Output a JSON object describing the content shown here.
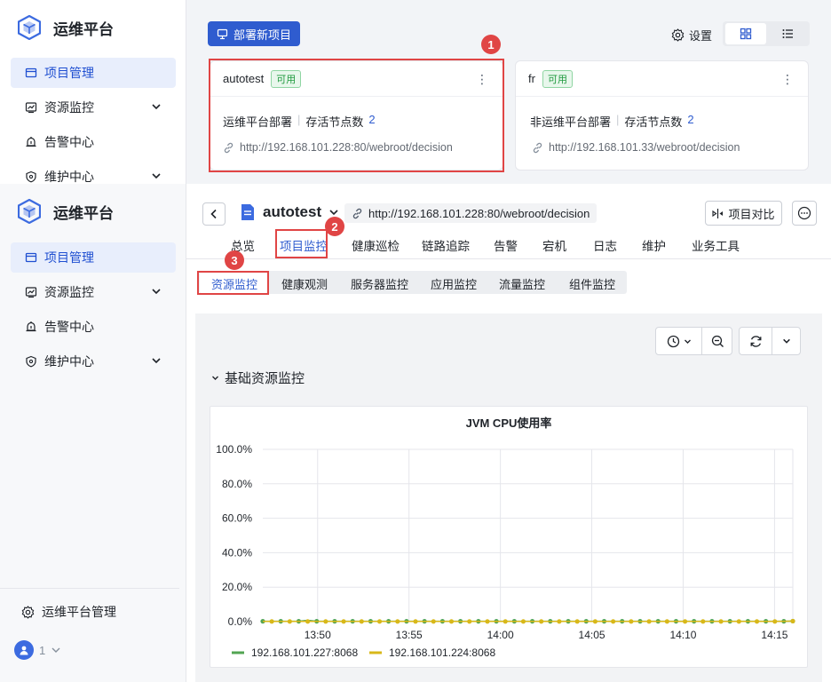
{
  "app": {
    "name": "运维平台"
  },
  "sidebar": {
    "items": [
      {
        "label": "项目管理",
        "active": true,
        "icon": "folder-icon"
      },
      {
        "label": "资源监控",
        "active": false,
        "icon": "chart-icon",
        "expandable": true
      },
      {
        "label": "告警中心",
        "active": false,
        "icon": "alarm-icon"
      },
      {
        "label": "维护中心",
        "active": false,
        "icon": "wrench-icon",
        "expandable": true
      }
    ],
    "admin_label": "运维平台管理",
    "user_name": "1"
  },
  "project_list": {
    "deploy_button": "部署新项目",
    "settings_label": "设置",
    "cards": [
      {
        "name": "autotest",
        "status": "可用",
        "type": "运维平台部署",
        "nodes_label": "存活节点数",
        "nodes": "2",
        "url": "http://192.168.101.228:80/webroot/decision"
      },
      {
        "name": "fr",
        "status": "可用",
        "type": "非运维平台部署",
        "nodes_label": "存活节点数",
        "nodes": "2",
        "url": "http://192.168.101.33/webroot/decision"
      }
    ]
  },
  "project_detail": {
    "name": "autotest",
    "url": "http://192.168.101.228:80/webroot/decision",
    "compare_button": "项目对比",
    "tabs": [
      "总览",
      "项目监控",
      "健康巡检",
      "链路追踪",
      "告警",
      "宕机",
      "日志",
      "维护",
      "业务工具"
    ],
    "active_tab": "项目监控",
    "sub_tabs": [
      "资源监控",
      "健康观测",
      "服务器监控",
      "应用监控",
      "流量监控",
      "组件监控"
    ],
    "active_sub_tab": "资源监控",
    "section_title": "基础资源监控"
  },
  "markers": [
    "1",
    "2",
    "3"
  ],
  "colors": {
    "primary": "#2f5ccf",
    "highlight": "#e04545",
    "series1": "#52a452",
    "series2": "#d8b81a"
  },
  "chart_data": {
    "type": "line",
    "title": "JVM CPU使用率",
    "ylim": [
      0,
      100
    ],
    "yticks": [
      "0.0%",
      "20.0%",
      "40.0%",
      "60.0%",
      "80.0%",
      "100.0%"
    ],
    "xticks": [
      "13:50",
      "13:55",
      "14:00",
      "14:05",
      "14:10",
      "14:15"
    ],
    "x_start": "13:47",
    "x_end": "14:16",
    "series": [
      {
        "name": "192.168.101.227:8068",
        "color": "#52a452",
        "values": [
          0.2,
          0.2,
          0.2,
          0.2,
          0.2,
          0.8,
          0.2,
          0.2,
          0.2,
          0.2,
          0.2,
          0.2,
          0.2,
          0.2,
          0.2,
          0.2,
          0.2,
          0.2,
          0.2,
          0.2,
          0.2,
          0.2,
          0.2,
          0.2,
          0.2,
          0.2,
          0.2,
          0.2,
          0.2,
          0.2,
          0.2,
          0.2,
          0.2,
          0.2,
          0.2,
          0.2,
          0.2,
          0.2,
          0.2,
          0.2,
          0.2,
          0.2,
          0.2,
          0.2,
          0.2,
          0.2,
          0.2,
          0.2,
          0.2,
          0.2,
          0.2,
          0.2,
          0.2,
          0.2,
          0.2,
          0.2,
          0.2,
          0.2,
          0.2,
          0.3
        ]
      },
      {
        "name": "192.168.101.224:8068",
        "color": "#d8b81a",
        "values": [
          0.1,
          0.1,
          0.1,
          0.1,
          0.1,
          0.1,
          0.1,
          0.1,
          0.1,
          0.1,
          0.1,
          0.1,
          0.1,
          0.1,
          0.1,
          0.1,
          0.1,
          0.1,
          0.1,
          0.1,
          0.1,
          0.1,
          0.1,
          0.1,
          0.1,
          0.1,
          0.1,
          0.1,
          0.1,
          0.1,
          0.1,
          0.1,
          0.1,
          0.1,
          0.1,
          0.1,
          0.1,
          0.1,
          0.1,
          0.1,
          0.1,
          0.1,
          0.1,
          0.1,
          0.1,
          0.1,
          0.1,
          0.1,
          0.1,
          0.1,
          0.1,
          0.1,
          0.1,
          0.1,
          0.1,
          0.1,
          0.1,
          0.1,
          0.2,
          0.3
        ]
      }
    ]
  }
}
